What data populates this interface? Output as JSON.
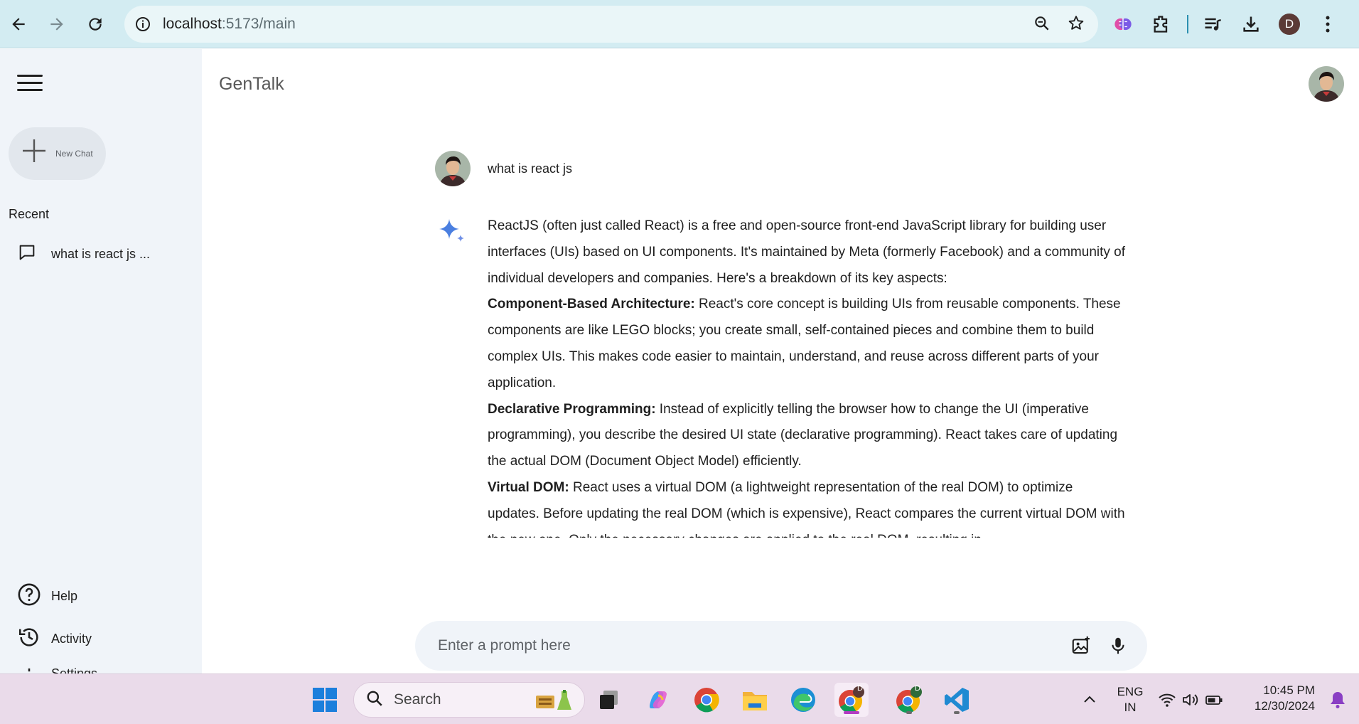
{
  "browser": {
    "url_host": "localhost",
    "url_path": ":5173/main",
    "profile_initial": "D"
  },
  "app": {
    "title": "GenTalk"
  },
  "sidebar": {
    "new_chat_label": "New Chat",
    "recent_title": "Recent",
    "recent_items": [
      {
        "label": "what is react js ..."
      }
    ],
    "bottom_items": [
      {
        "label": "Help",
        "icon": "help-icon"
      },
      {
        "label": "Activity",
        "icon": "history-icon"
      },
      {
        "label": "Settings",
        "icon": "settings-icon"
      }
    ]
  },
  "chat": {
    "question": "what is react js",
    "answer": {
      "intro": "ReactJS (often just called React) is a free and open-source front-end JavaScript library for building user interfaces (UIs) based on UI components. It's maintained by Meta (formerly Facebook) and a community of individual developers and companies. Here's a breakdown of its key aspects:",
      "points": [
        {
          "heading": "Component-Based Architecture:",
          "body": " React's core concept is building UIs from reusable components. These components are like LEGO blocks; you create small, self-contained pieces and combine them to build complex UIs. This makes code easier to maintain, understand, and reuse across different parts of your application."
        },
        {
          "heading": "Declarative Programming:",
          "body": " Instead of explicitly telling the browser how to change the UI (imperative programming), you describe the desired UI state (declarative programming). React takes care of updating the actual DOM (Document Object Model) efficiently."
        },
        {
          "heading": "Virtual DOM:",
          "body": " React uses a virtual DOM (a lightweight representation of the real DOM) to optimize updates. Before updating the real DOM (which is expensive), React compares the current virtual DOM with the new one. Only the necessary changes are applied to the real DOM, resulting in"
        }
      ]
    }
  },
  "prompt": {
    "placeholder": "Enter a prompt here"
  },
  "taskbar": {
    "search_label": "Search",
    "language_line1": "ENG",
    "language_line2": "IN",
    "time": "10:45 PM",
    "date": "12/30/2024",
    "badge_initial": "D"
  },
  "colors": {
    "chrome_bg": "#d3ecf2",
    "sidebar_bg": "#f0f4f9",
    "gemini_blue": "#4a7fe0",
    "taskbar_bg": "#eadbea"
  }
}
